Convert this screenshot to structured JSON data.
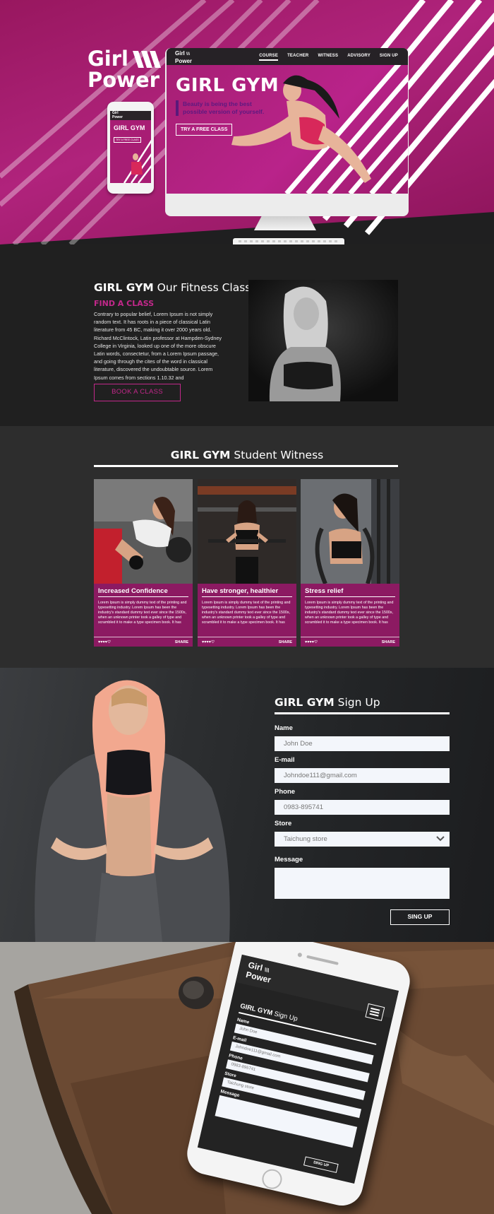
{
  "brand": {
    "line1": "Girl",
    "line2": "Power"
  },
  "hero_screen": {
    "logo_line1": "Girl",
    "logo_line2": "Power",
    "nav": [
      "COURSE",
      "TEACHER",
      "WITNESS",
      "ADVISORY",
      "SIGN UP"
    ],
    "active_nav": "COURSE",
    "title": "GIRL GYM",
    "tagline": "Beauty is being the best possible version of yourself.",
    "cta": "TRY  A FREE CLASS"
  },
  "hero_phone": {
    "logo_line1": "Girl",
    "logo_line2": "Power",
    "title": "GIRL GYM",
    "cta": "TRY A FREE CLASS"
  },
  "classes": {
    "title_bold": "GIRL GYM",
    "title_rest": " Our Fitness Classes",
    "subtitle": "FIND A CLASS",
    "paragraph": "Contrary to popular belief, Lorem Ipsum is not simply random text. It has roots in a piece of classical Latin literature from 45 BC, making it over 2000 years old. Richard McClintock, Latin professor at Hampden-Sydney College in Virginia, looked up one of the more obscure Latin words, consectetur, from a Lorem Ipsum passage, and going through the cites of the word in classical literature, discovered the undoubtable source. Lorem Ipsum comes from sections 1.10.32 and",
    "button": "BOOK A CLASS"
  },
  "witness": {
    "title_bold": "GIRL GYM",
    "title_rest": " Student Witness",
    "cards": [
      {
        "title": "Increased Confidence",
        "body": "Lorem Ipsum is simply dummy text of the printing and typesetting industry. Lorem Ipsum has been the industry's standard dummy text ever since the 1500s, when an unknown printer took a galley of type and scrambled it to make a type specimen book. It has",
        "rating": "♥♥♥♥♡",
        "share": "SHARE"
      },
      {
        "title": "Have stronger, healthier",
        "body": "Lorem Ipsum is simply dummy text of the printing and typesetting industry. Lorem Ipsum has been the industry's standard dummy text ever since the 1500s, when an unknown printer took a galley of type and scrambled it to make a type specimen book. It has",
        "rating": "♥♥♥♥♡",
        "share": "SHARE"
      },
      {
        "title": "Stress relief",
        "body": "Lorem Ipsum is simply dummy text of the printing and typesetting industry. Lorem Ipsum has been the industry's standard dummy text ever since the 1500s, when an unknown printer took a galley of type and scrambled it to make a type specimen book. It has",
        "rating": "♥♥♥♥♡",
        "share": "SHARE"
      }
    ]
  },
  "signup": {
    "title_bold": "GIRL GYM",
    "title_rest": " Sign Up",
    "name_label": "Name",
    "name_value": "John Doe",
    "email_label": "E-mail",
    "email_value": "Johndoe111@gmail.com",
    "phone_label": "Phone",
    "phone_value": "0983-895741",
    "store_label": "Store",
    "store_value": "Taichung store",
    "message_label": "Message",
    "message_value": "",
    "button": "SING UP"
  },
  "mobile_mock": {
    "logo_line1": "Girl",
    "logo_line2": "Power",
    "title_bold": "GIRL GYM",
    "title_rest": " Sign Up",
    "name_label": "Name",
    "name_value": "John Doe",
    "email_label": "E-mail",
    "email_value": "Johndoe111@gmail.com",
    "phone_label": "Phone",
    "phone_value": "0983-895741",
    "store_label": "Store",
    "store_value": "Taichung store",
    "message_label": "Message",
    "button": "SING UP"
  },
  "colors": {
    "magenta": "#b0237c",
    "accent_pink": "#c2288a",
    "card_purple": "#8c1a62",
    "dark_bg": "#202020",
    "section_bg": "#2d2d2d"
  }
}
